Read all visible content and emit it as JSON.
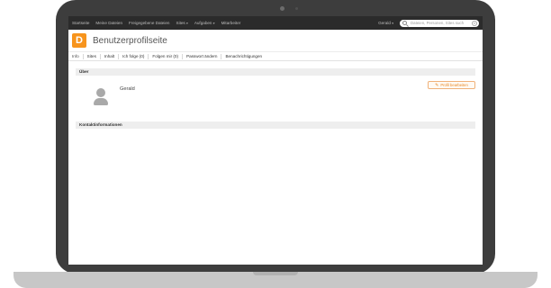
{
  "topbar": {
    "nav": [
      {
        "label": "Startseite"
      },
      {
        "label": "Meine Dateien"
      },
      {
        "label": "Freigegebene Dateien"
      },
      {
        "label": "Sites"
      },
      {
        "label": "Aufgaben"
      },
      {
        "label": "Mitarbeiter"
      }
    ],
    "user_label": "Gerald",
    "search_placeholder": "Dateien, Personen, Sites such"
  },
  "header": {
    "logo_letter": "D",
    "title": "Benutzerprofilseite"
  },
  "tabs": [
    {
      "label": "Info",
      "active": true
    },
    {
      "label": "Sites"
    },
    {
      "label": "Inhalt"
    },
    {
      "label": "Ich folge (0)"
    },
    {
      "label": "Folgen mir (0)"
    },
    {
      "label": "Passwort ändern"
    },
    {
      "label": "Benachrichtigungen"
    }
  ],
  "about": {
    "heading": "Über",
    "name": "Gerald",
    "edit_label": "Profil bearbeiten"
  },
  "contact": {
    "heading": "Kontaktinformationen"
  },
  "colors": {
    "accent": "#f7941d",
    "topbar": "#2b2b2b",
    "laptop_frame": "#3d3d3d"
  },
  "icons": {
    "search": "search-icon",
    "clear": "close-icon",
    "edit": "pencil-icon",
    "avatar": "user-avatar-icon"
  }
}
